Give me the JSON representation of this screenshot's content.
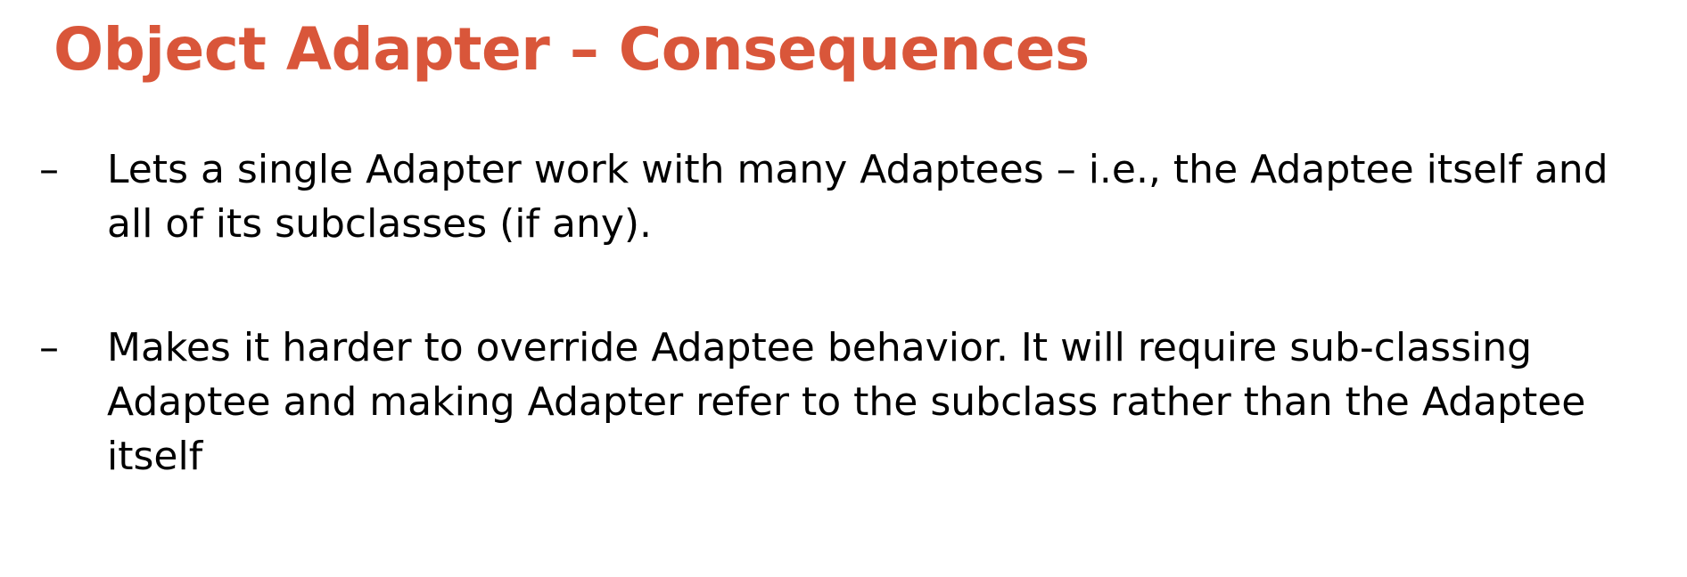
{
  "slide": {
    "title": "Object Adapter – Consequences",
    "title_color": "#d9563a",
    "bullet_marker": "–",
    "bullets": [
      {
        "text": "Lets a single Adapter work with many Adaptees – i.e., the Adaptee itself and all of its subclasses (if any)."
      },
      {
        "text": "Makes it harder to override Adaptee behavior. It will require sub-classing Adaptee and making Adapter refer to the subclass rather than the Adaptee itself"
      }
    ]
  }
}
